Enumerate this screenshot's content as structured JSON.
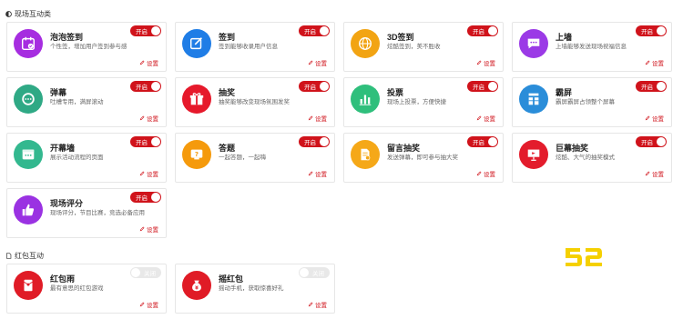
{
  "sections": {
    "interactive": "现场互动类",
    "redpacket": "红包互动"
  },
  "toggle_on": "开启",
  "toggle_off": "关闭",
  "settings_label": "设置",
  "cards": [
    {
      "title": "泡泡签到",
      "desc": "个性签，增加用户签到参与感",
      "on": true,
      "color": "#a62de0",
      "icon": "calendar-check-icon"
    },
    {
      "title": "签到",
      "desc": "签到能够收录用户信息",
      "on": true,
      "color": "#1f7de6",
      "icon": "edit-check-icon"
    },
    {
      "title": "3D签到",
      "desc": "炫酷签到，美不胜收",
      "on": true,
      "color": "#f2a413",
      "icon": "globe-icon"
    },
    {
      "title": "上墙",
      "desc": "上墙能够发送现场祝福信息",
      "on": true,
      "color": "#9b3ae6",
      "icon": "chat-icon"
    },
    {
      "title": "弹幕",
      "desc": "吐槽专用，满屏滚动",
      "on": true,
      "color": "#2fa985",
      "icon": "bubble-dots-icon"
    },
    {
      "title": "抽奖",
      "desc": "抽奖能够改变现场氛围发奖",
      "on": true,
      "color": "#e6192b",
      "icon": "gift-icon"
    },
    {
      "title": "投票",
      "desc": "现场上投票，方便快捷",
      "on": true,
      "color": "#2fbf7c",
      "icon": "bar-chart-icon"
    },
    {
      "title": "霸屏",
      "desc": "霸屏霸屏占领整个屏幕",
      "on": true,
      "color": "#2a8dd9",
      "icon": "ba-char-icon"
    },
    {
      "title": "开幕墙",
      "desc": "展示活动流程的页面",
      "on": true,
      "color": "#33b88f",
      "icon": "window-icon"
    },
    {
      "title": "答题",
      "desc": "一起答题，一起嗨",
      "on": true,
      "color": "#f59a0c",
      "icon": "quiz-icon"
    },
    {
      "title": "留言抽奖",
      "desc": "发送弹幕，即可参与抽大奖",
      "on": true,
      "color": "#f5a818",
      "icon": "document-icon"
    },
    {
      "title": "巨幕抽奖",
      "desc": "炫酷、大气的抽奖模式",
      "on": true,
      "color": "#e31c2c",
      "icon": "presentation-icon"
    },
    {
      "title": "现场评分",
      "desc": "现场评分，节目比赛，竞选必备应用",
      "on": true,
      "color": "#9a32e2",
      "icon": "thumbs-up-icon"
    },
    {
      "title": "红包雨",
      "desc": "最有意思的红包游戏",
      "on": false,
      "color": "#e01b26",
      "icon": "red-envelope-icon"
    },
    {
      "title": "摇红包",
      "desc": "摇动手机，获取惊喜好礼",
      "on": false,
      "color": "#e01b26",
      "icon": "money-bag-icon"
    }
  ],
  "logo_text": "52"
}
